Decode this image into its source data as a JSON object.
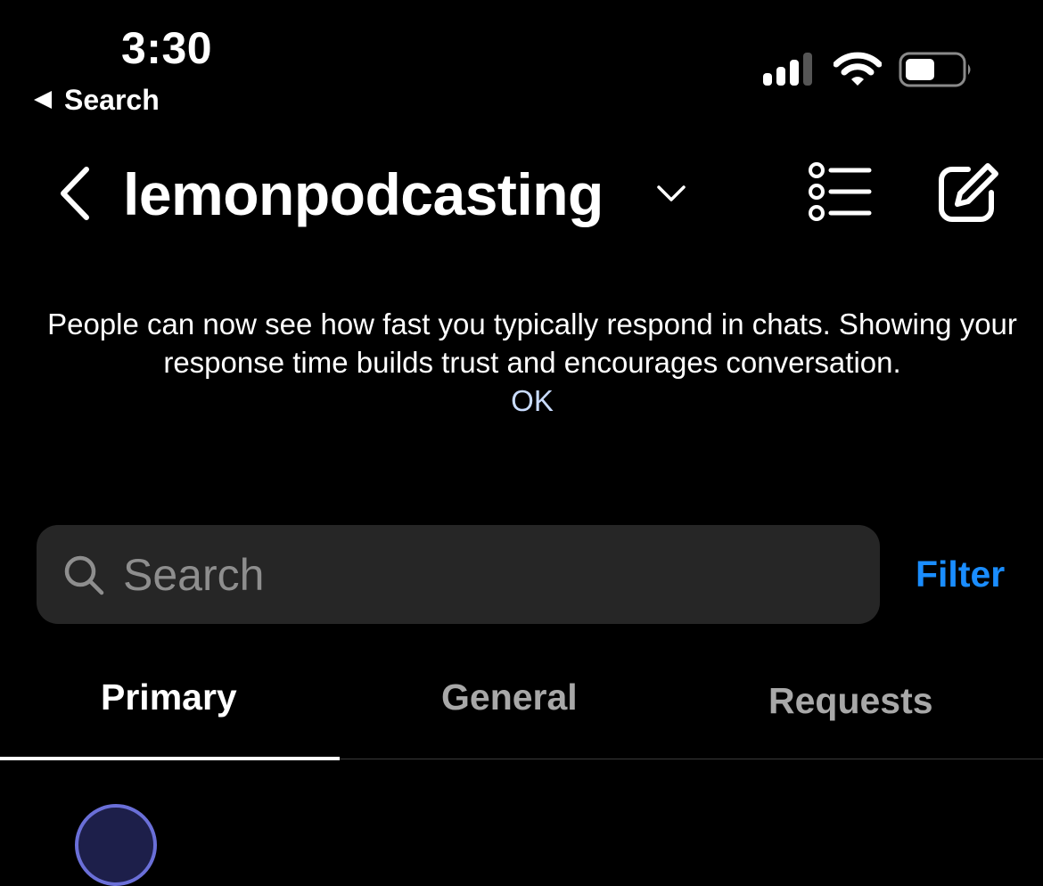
{
  "status_bar": {
    "time": "3:30",
    "back_label": "Search",
    "icons": [
      "cellular-signal-icon",
      "wifi-icon",
      "battery-icon"
    ]
  },
  "header": {
    "back_icon": "chevron-left-icon",
    "account_name": "lemonpodcasting",
    "account_chevron": "chevron-down-icon",
    "list_icon": "list-icon",
    "compose_icon": "compose-icon"
  },
  "notice": {
    "message": "People can now see how fast you typically respond in chats. Showing your response time builds trust and encourages conversation.",
    "ok_label": "OK"
  },
  "search": {
    "placeholder": "Search",
    "filter_label": "Filter"
  },
  "tabs": [
    {
      "label": "Primary",
      "active": true
    },
    {
      "label": "General",
      "active": false
    },
    {
      "label": "Requests",
      "active": false
    }
  ],
  "colors": {
    "background": "#000000",
    "accent": "#1a8dff",
    "search_bg": "#262626",
    "ok_link": "#c9dcff"
  }
}
